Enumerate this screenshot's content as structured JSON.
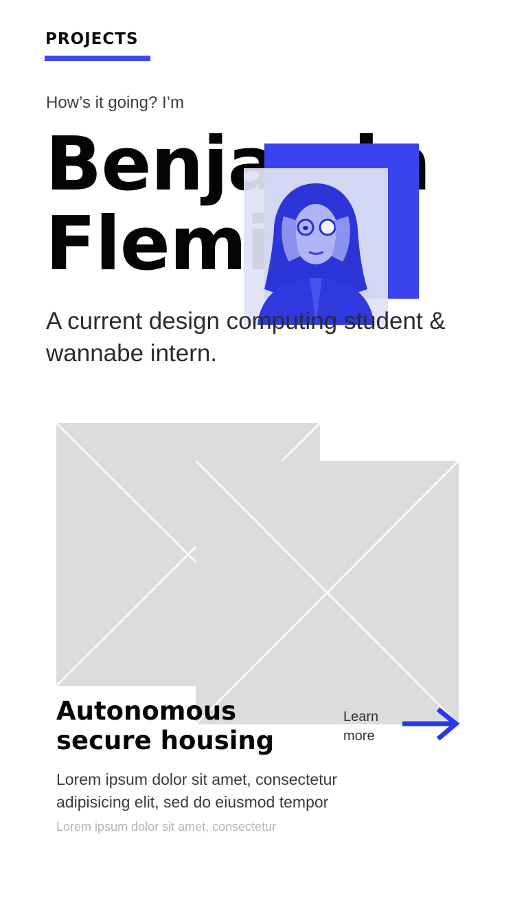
{
  "header": {
    "nav_label": "PROJECTS"
  },
  "intro": {
    "greeting": "How’s it going? I’m",
    "name_line_1": "Benjamin",
    "name_line_2": "Fleming",
    "subtitle": "A current design computing student & wannabe intern.",
    "portrait_icon": "person-portrait-image"
  },
  "project": {
    "title": "Autonomous secure housing",
    "cta_label": "Learn more",
    "cta_icon": "arrow-right-icon",
    "description": "Lorem ipsum dolor sit amet, consectetur adipisicing elit, sed do eiusmod tempor",
    "meta": "Lorem ipsum dolor sit amet, consectetur"
  },
  "colors": {
    "accent": "#3a44ec",
    "placeholder": "#dcdcdc",
    "text": "#050505"
  }
}
